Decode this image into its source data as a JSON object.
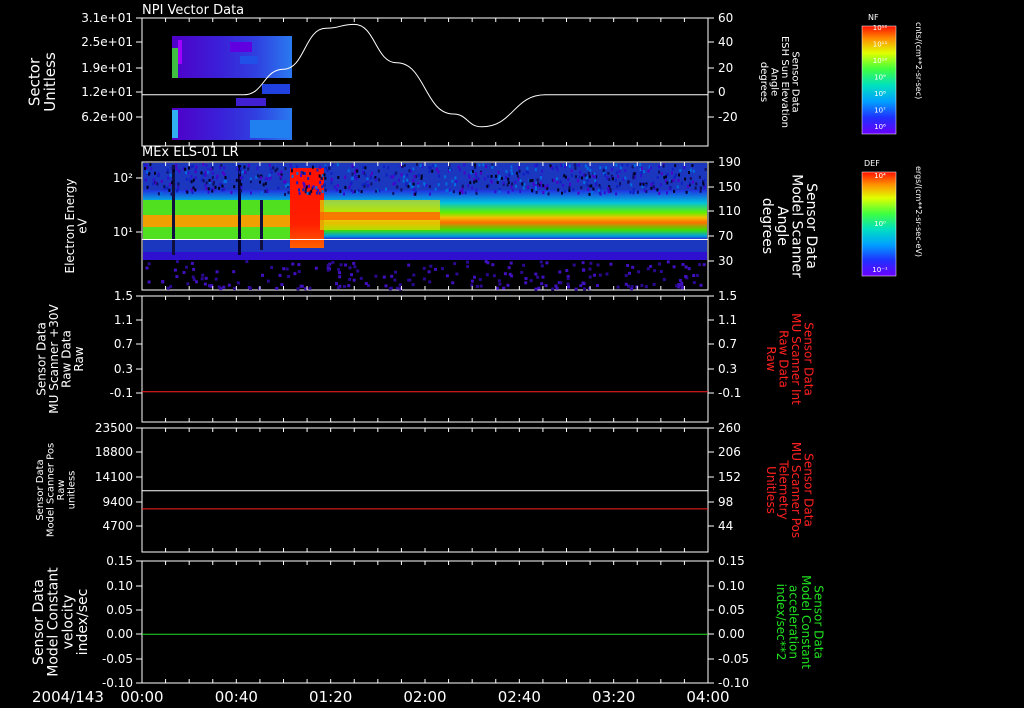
{
  "date_label": "2004/143",
  "time_ticks": [
    "00:00",
    "00:40",
    "01:20",
    "02:00",
    "02:40",
    "03:20",
    "04:00"
  ],
  "colors": {
    "axis": "#ffffff",
    "red_trace": "#ff2020",
    "green_trace": "#20e020",
    "white_trace": "#ffffff"
  },
  "colorbars": [
    {
      "title": "NF",
      "unit": "cnts/(cm**2-sr-sec)",
      "tick_labels": [
        "10¹²",
        "10¹¹",
        "10¹⁰",
        "10⁹",
        "10⁸",
        "10⁷",
        "10⁶"
      ]
    },
    {
      "title": "DEF",
      "unit": "ergs/(cm**2-sr-sec-eV)",
      "tick_labels": [
        "10⁴",
        "10⁰",
        "10⁻¹"
      ]
    }
  ],
  "chart_data": [
    {
      "type": "heatmap",
      "title": "NPI Vector Data",
      "ylabel_left": [
        "Sector",
        "Unitless"
      ],
      "ylabel_right": [
        "Sensor Data",
        "ESH Sun Elevation",
        "Angle",
        "degrees"
      ],
      "left_ticks": [
        "3.1e+01",
        "2.5e+01",
        "1.9e+01",
        "1.2e+01",
        "6.2e+00"
      ],
      "right_ticks": [
        "60",
        "40",
        "20",
        "0",
        "-20"
      ],
      "right_ylim": [
        -40,
        60
      ],
      "overlay_line": {
        "x_hours": [
          0.0,
          0.72,
          1.0,
          1.3,
          1.5,
          1.8,
          2.2,
          2.4,
          2.85,
          4.0
        ],
        "values": [
          0,
          0,
          20,
          52,
          55,
          25,
          -15,
          -25,
          0,
          0
        ]
      }
    },
    {
      "type": "heatmap",
      "title": "MEx ELS-01 LR",
      "ylabel_left": [
        "Electron Energy",
        "eV"
      ],
      "ylabel_right": [
        "Sensor Data",
        "Model Scanner",
        "Angle",
        "degrees"
      ],
      "left_ticks": [
        "10²",
        "10¹"
      ],
      "right_ticks": [
        "190",
        "150",
        "110",
        "70",
        "30"
      ],
      "right_ylim": [
        0,
        190
      ],
      "overlay_line": {
        "x_hours": [
          0.0,
          4.0
        ],
        "values": [
          75,
          75
        ]
      }
    },
    {
      "type": "line",
      "ylabel_left": [
        "Sensor Data",
        "MU Scanner +30V",
        "Raw Data",
        "Raw"
      ],
      "ylabel_right": [
        "Sensor Data",
        "MU Scanner Int",
        "Raw Data",
        "Raw"
      ],
      "left_ticks": [
        "1.5",
        "1.1",
        "0.7",
        "0.3",
        "-0.1"
      ],
      "right_ticks": [
        "1.5",
        "1.1",
        "0.7",
        "0.3",
        "-0.1"
      ],
      "ylim": [
        -0.5,
        1.5
      ],
      "series": [
        {
          "x_hours": [
            0.0,
            4.0
          ],
          "values": [
            -0.02,
            -0.02
          ],
          "color": "#ff2020"
        }
      ]
    },
    {
      "type": "line",
      "ylabel_left": [
        "Sensor Data",
        "Model Scanner Pos",
        "Raw",
        "unitless"
      ],
      "ylabel_right": [
        "Sensor Data",
        "MU Scanner Pos",
        "Telemetry",
        "Unitless"
      ],
      "left_ticks": [
        "23500",
        "18800",
        "14100",
        "9400",
        "4700"
      ],
      "right_ticks": [
        "260",
        "206",
        "152",
        "98",
        "44"
      ],
      "ylim_left": [
        0,
        23500
      ],
      "ylim_right": [
        -10,
        260
      ],
      "series": [
        {
          "axis": "left",
          "x_hours": [
            0.0,
            4.0
          ],
          "values": [
            11600,
            11600
          ],
          "color": "#ffffff"
        },
        {
          "axis": "right",
          "x_hours": [
            0.0,
            4.0
          ],
          "values": [
            84,
            84
          ],
          "color": "#ff2020"
        }
      ]
    },
    {
      "type": "line",
      "ylabel_left": [
        "Sensor Data",
        "Model Constant",
        "velocity",
        "index/sec"
      ],
      "ylabel_right": [
        "Sensor Data",
        "Model Constant",
        "acceleration",
        "index/sec**2"
      ],
      "left_ticks": [
        "0.15",
        "0.10",
        "0.05",
        "0.00",
        "-0.05",
        "-0.10"
      ],
      "right_ticks": [
        "0.15",
        "0.10",
        "0.05",
        "0.00",
        "-0.05",
        "-0.10"
      ],
      "ylim": [
        -0.1,
        0.15
      ],
      "series": [
        {
          "x_hours": [
            0.0,
            4.0
          ],
          "values": [
            0.0,
            0.0
          ],
          "color": "#20e020"
        }
      ]
    }
  ]
}
